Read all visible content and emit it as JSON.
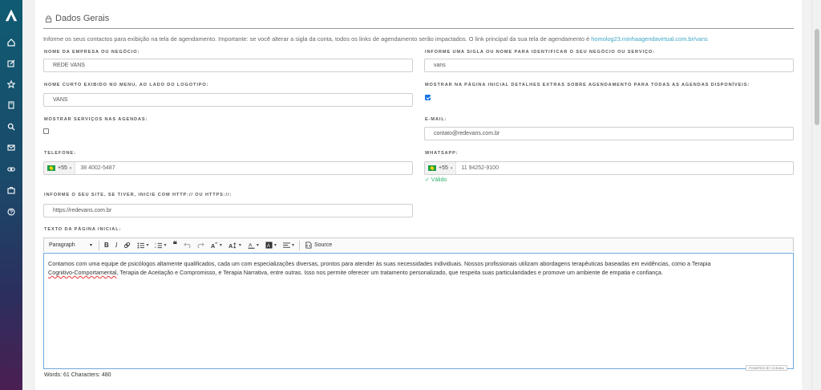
{
  "section": {
    "title": "Dados Gerais"
  },
  "info": {
    "text": "Informe os seus contactos para exibição na tela de agendamento. Importante: se você alterar a sigla da conta, todos os links de agendamento serão impactados. O link principal da sua tela de agendamento é ",
    "link": "homolog23.minhaagendavirtual.com.br/vans"
  },
  "fields": {
    "company_name": {
      "label": "Nome da empresa ou negócio:",
      "value": "REDE VANS"
    },
    "acronym": {
      "label": "Informe uma sigla ou nome para identificar o seu negócio ou serviço:",
      "value": "vans"
    },
    "short_name": {
      "label": "Nome curto exibido no menu, ao lado do logotipo:",
      "value": "VANS"
    },
    "show_extra": {
      "label": "Mostrar na página inicial detalhes extras sobre agendamento para todas as agendas disponíveis:",
      "checked": true
    },
    "show_services": {
      "label": "Mostrar serviços nas agendas:",
      "checked": false
    },
    "email": {
      "label": "E-mail:",
      "value": "contato@redevans.com.br"
    },
    "phone": {
      "label": "Telefone:",
      "country_code": "+55",
      "value": "38 4002-5487"
    },
    "whatsapp": {
      "label": "Whatsapp:",
      "country_code": "+55",
      "value": "11 94252-9100",
      "status": "✓ Válido"
    },
    "site": {
      "label": "Informe o seu site, se tiver, inicie com http:// ou https://:",
      "value": "https://redevans.com.br"
    },
    "home_text": {
      "label": "Texto da página inicial:"
    }
  },
  "toolbar": {
    "paragraph": "Paragraph",
    "bold": "B",
    "italic": "I",
    "quote": "❝",
    "source": "Source"
  },
  "editor": {
    "line1": "Contamos com uma equipe de psicólogos altamente qualificados, cada um com especializações diversas, prontos para atender às suas necessidades individuais. Nossos profissionais utilizam abordagens terapêuticas baseadas em evidências, como a Terapia",
    "word_underlined": "Cognitivo-Comportamental",
    "line2_rest": ", Terapia de Aceitação e Compromisso, e Terapia Narrativa, entre outras. Isso nos permite oferecer um tratamento personalizado, que respeita suas particularidades e promove um ambiente de empatia e confiança.",
    "powered": "POWERED BY CKEditor"
  },
  "counts": {
    "text": "Words: 61  Characters: 480"
  },
  "colors": {
    "accent": "#3da7c6",
    "valid": "#2fb36b",
    "sidebar_top": "#0f5b72",
    "sidebar_bottom": "#4b1f52"
  }
}
